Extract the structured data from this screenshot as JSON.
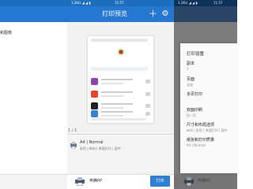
{
  "left_panel": {
    "partial_label": "和图像"
  },
  "status_bar": {
    "signal": "1.2K/s ◢ ◢ ▮",
    "time": "11:57"
  },
  "preview": {
    "title": "打印预览",
    "page_count": "1 / 1",
    "paper_summary": "A4 | Normal",
    "paper_detail": "彩色 | 纵向 | 单面打印 | 面中",
    "printer_name": "奔腾PP",
    "print_button": "打印"
  },
  "settings_sheet": {
    "heading": "打印设置",
    "options": [
      {
        "label": "副本",
        "value": "1"
      },
      {
        "label": "页面",
        "value": "全部"
      },
      {
        "label": "多页打印",
        "value": ""
      },
      {
        "label": "双面印刷",
        "value": "仅一页"
      },
      {
        "label": "尺寸和布局选项",
        "value": "纵向 | 彩色 | 单面打印 | 面中"
      },
      {
        "label": "纸张和打印质量",
        "value": "A4 | Normal"
      }
    ]
  },
  "colors": {
    "toolbar": "#2478d2",
    "status_bar": "#1e6ebe",
    "print_button": "#2f7fd4",
    "overlay": "#7c7c7c"
  }
}
